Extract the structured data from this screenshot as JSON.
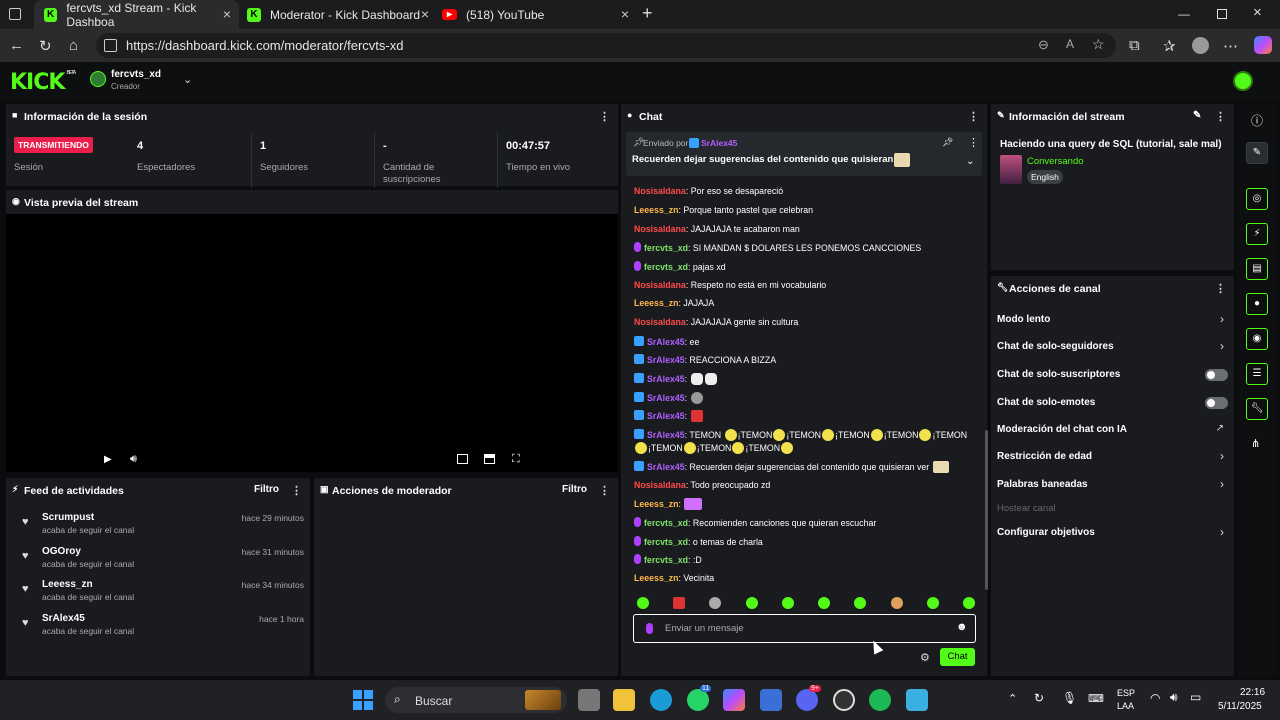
{
  "browser": {
    "tabs": [
      {
        "label": "fercvts_xd Stream - Kick Dashboa",
        "active": true
      },
      {
        "label": "Moderator - Kick Dashboard",
        "active": false
      },
      {
        "label": "(518) YouTube",
        "active": false
      }
    ],
    "url": "https://dashboard.kick.com/moderator/fercvts-xd"
  },
  "header": {
    "logo": "KICK",
    "beta": "BETA",
    "channel": "fercvts_xd",
    "role": "Creador"
  },
  "session": {
    "title": "Información de la sesión",
    "status_badge": "TRANSMITIENDO",
    "status_label": "Sesión",
    "stats": [
      {
        "value": "4",
        "label": "Espectadores"
      },
      {
        "value": "1",
        "label": "Seguidores"
      },
      {
        "value": "-",
        "label": "Cantidad de suscripciones"
      },
      {
        "value": "00:47:57",
        "label": "Tiempo en vivo"
      }
    ]
  },
  "preview": {
    "title": "Vista previa del stream"
  },
  "feed": {
    "title": "Feed de actividades",
    "filter": "Filtro",
    "items": [
      {
        "name": "Scrumpust",
        "sub": "acaba de seguir el canal",
        "time": "hace 29 minutos"
      },
      {
        "name": "OGOroy",
        "sub": "acaba de seguir el canal",
        "time": "hace 31 minutos"
      },
      {
        "name": "Leeess_zn",
        "sub": "acaba de seguir el canal",
        "time": "hace 34 minutos"
      },
      {
        "name": "SrAlex45",
        "sub": "acaba de seguir el canal",
        "time": "hace 1 hora"
      }
    ]
  },
  "modactions": {
    "title": "Acciones de moderador",
    "filter": "Filtro"
  },
  "chat": {
    "title": "Chat",
    "pinned_by": "Enviado por",
    "pinned_user": "SrAlex45",
    "pinned_text": "Recuerden dejar sugerencias del contenido que quisieran ver",
    "messages": [
      {
        "user": "Nosisaldana",
        "text": ": Por eso se desapareció",
        "color": "red"
      },
      {
        "user": "Leeess_zn",
        "text": ": Porque tanto pastel que celebran",
        "color": "org"
      },
      {
        "user": "Nosisaldana",
        "text": ": JAJAJAJA te acabaron man",
        "color": "red"
      },
      {
        "user": "fercvts_xd",
        "text": ": SI MANDAN $ DOLARES LES PONEMOS CANCCIONES",
        "color": "grn"
      },
      {
        "user": "fercvts_xd",
        "text": ": pajas xd",
        "color": "grn"
      },
      {
        "user": "Nosisaldana",
        "text": ": Respeto no está en mi vocabulario",
        "color": "red"
      },
      {
        "user": "Leeess_zn",
        "text": ": JAJAJA",
        "color": "org"
      },
      {
        "user": "Nosisaldana",
        "text": ": JAJAJAJA gente sin cultura",
        "color": "red"
      },
      {
        "user": "SrAlex45",
        "text": ": ee",
        "color": "pur"
      },
      {
        "user": "SrAlex45",
        "text": ": REACCIONA A BIZZA",
        "color": "pur"
      },
      {
        "user": "SrAlex45",
        "text": ":",
        "color": "pur"
      },
      {
        "user": "SrAlex45",
        "text": ":",
        "color": "pur"
      },
      {
        "user": "SrAlex45",
        "text": ":",
        "color": "pur"
      },
      {
        "user": "SrAlex45",
        "text": ": TEMON",
        "color": "pur"
      },
      {
        "user": "SrAlex45",
        "text": ": Recuerden dejar sugerencias del contenido que quisieran ver",
        "color": "pur"
      },
      {
        "user": "Nosisaldana",
        "text": ": Todo preocupado zd",
        "color": "red"
      },
      {
        "user": "Leeess_zn",
        "text": ":",
        "color": "org"
      },
      {
        "user": "fercvts_xd",
        "text": ": Recomienden canciones que quieran escuchar",
        "color": "grn"
      },
      {
        "user": "fercvts_xd",
        "text": ": o temas de charla",
        "color": "grn"
      },
      {
        "user": "fercvts_xd",
        "text": ": :D",
        "color": "grn"
      },
      {
        "user": "Leeess_zn",
        "text": ": Vecinita",
        "color": "org"
      }
    ],
    "temon": "¡TEMON",
    "input_placeholder": "Enviar un mensaje",
    "send": "Chat"
  },
  "stream_info": {
    "title": "Información del stream",
    "stream_title": "Haciendo una query de SQL (tutorial, sale mal)",
    "category": "Conversando",
    "language": "English"
  },
  "channel_actions": {
    "title": "Acciones de canal",
    "items": [
      "Modo lento",
      "Chat de solo-seguidores",
      "Chat de solo-suscriptores",
      "Chat de solo-emotes",
      "Moderación del chat con IA",
      "Restricción de edad",
      "Palabras baneadas",
      "Hostear canal",
      "Configurar objetivos"
    ]
  },
  "taskbar": {
    "search": "Buscar",
    "lang1": "ESP",
    "lang2": "LAA",
    "time": "22:16",
    "date": "5/11/2025",
    "whatsapp_badge": "11",
    "discord_badge": "9+"
  },
  "colors": {
    "kick_green": "#53fc18",
    "badge_red": "#e91e4a"
  }
}
